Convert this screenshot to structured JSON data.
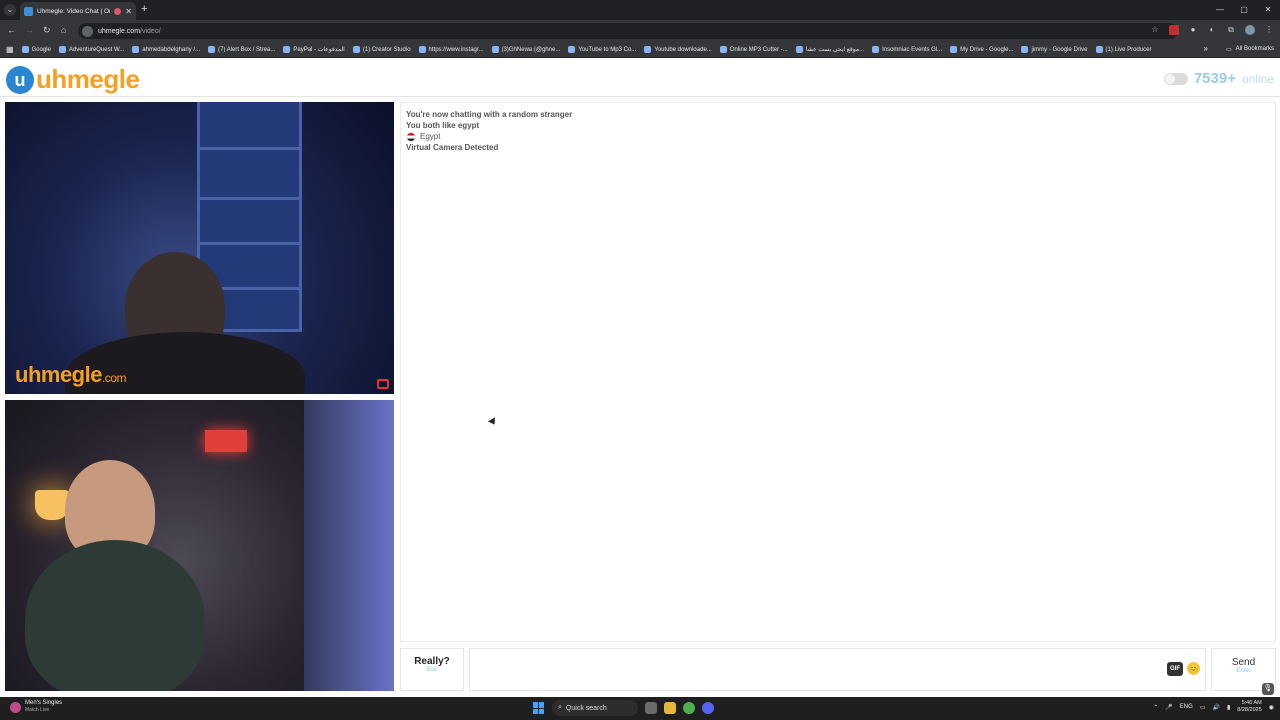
{
  "browser": {
    "tab_title": "Uhmegle: Video Chat | Om...",
    "tab_close": "✕",
    "new_tab": "+",
    "url_host": "uhmegle.com",
    "url_path": "/video/",
    "window_controls": [
      "—",
      "▢",
      "✕"
    ],
    "bookmarks": [
      "Google",
      "AdventureQuest W...",
      "ahmedabdelghany /...",
      "(7) Alert Box / Strea...",
      "PayPal - المدفوعات",
      "(1) Creator Studio",
      "https://www.instagr...",
      "(3)GhNewa (@ghne...",
      "YouTube to Mp3 Co...",
      "Youtube downloade...",
      "Online MP3 Cutter -...",
      "موقع ايجي بست عشا...",
      "Insomniac Events Gl...",
      "My Drive - Google...",
      "jimmy - Google Drive",
      "(1) Live Producer"
    ],
    "all_bookmarks": "All Bookmarks",
    "bookmarks_more": "»"
  },
  "site": {
    "logo_mark": "u",
    "logo_text": "uhmegle",
    "online_count": "7539+",
    "online_word": "online",
    "watermark_main": "uhmegle",
    "watermark_suffix": ".com"
  },
  "chat": {
    "messages": {
      "line1": "You're now chatting with a random stranger",
      "line2": "You both like egypt",
      "country": "Egypt",
      "line4": "Virtual Camera Detected"
    },
    "stop_button": {
      "label": "Really?",
      "hint": "Esc"
    },
    "gif_label": "GIF",
    "emoji": "😊",
    "send_button": {
      "label": "Send",
      "hint": "Enter"
    }
  },
  "taskbar": {
    "app_title": "Men's Singles",
    "app_subtitle": "Match Live",
    "search_placeholder": "Quick search",
    "lang": "ENG",
    "time": "5:46 AM",
    "date": "8/28/2025"
  },
  "colors": {
    "brand_orange": "#f5a023",
    "brand_blue": "#2b86d1",
    "online_blue": "#9ccaf0"
  }
}
